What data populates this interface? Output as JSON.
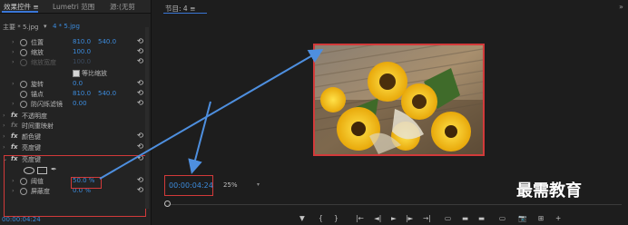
{
  "left_panel": {
    "tabs": [
      "效果控件 ≡",
      "Lumetri 范围",
      "源:(无剪"
    ],
    "source": {
      "master": "主要 * 5.jpg",
      "clip": "4 * 5.jpg",
      "clip_arrow": "▾"
    },
    "properties": [
      {
        "name": "位置",
        "values": [
          "810.0",
          "540.0"
        ]
      },
      {
        "name": "缩放",
        "values": [
          "100.0"
        ]
      },
      {
        "name": "缩放宽度",
        "values": [
          "100.0"
        ]
      },
      {
        "name": "等比缩放",
        "checked": true
      },
      {
        "name": "旋转",
        "values": [
          "0.0"
        ]
      },
      {
        "name": "锚点",
        "values": [
          "810.0",
          "540.0"
        ]
      },
      {
        "name": "防闪烁滤镜",
        "values": [
          "0.00"
        ]
      }
    ],
    "effects": [
      "不透明度",
      "时间重映射",
      "颜色键",
      "亮度键",
      "亮度键"
    ],
    "fx_label": "fx",
    "threshold": {
      "name": "阈值",
      "value": "50.0 %"
    },
    "cutoff": {
      "name": "屏蔽度",
      "value": "0.0 %"
    },
    "bottom_time": "00:00:04:24",
    "reset_symbol": "⟲"
  },
  "monitor": {
    "title": "节目: 4  ≡",
    "menu": "»",
    "timecode": "00:00:04:24",
    "zoom": "25%",
    "zoom_caret": "▾",
    "controls": [
      "▼",
      "{",
      "}",
      "|←",
      "◄|",
      "◄",
      "►",
      "|►",
      "→|",
      "⇥",
      "▭",
      "▬",
      "📷",
      "⊞",
      "+"
    ]
  },
  "watermark": "最需教育",
  "colors": {
    "accent": "#3c8bdc",
    "highlight": "#d23a3a"
  }
}
